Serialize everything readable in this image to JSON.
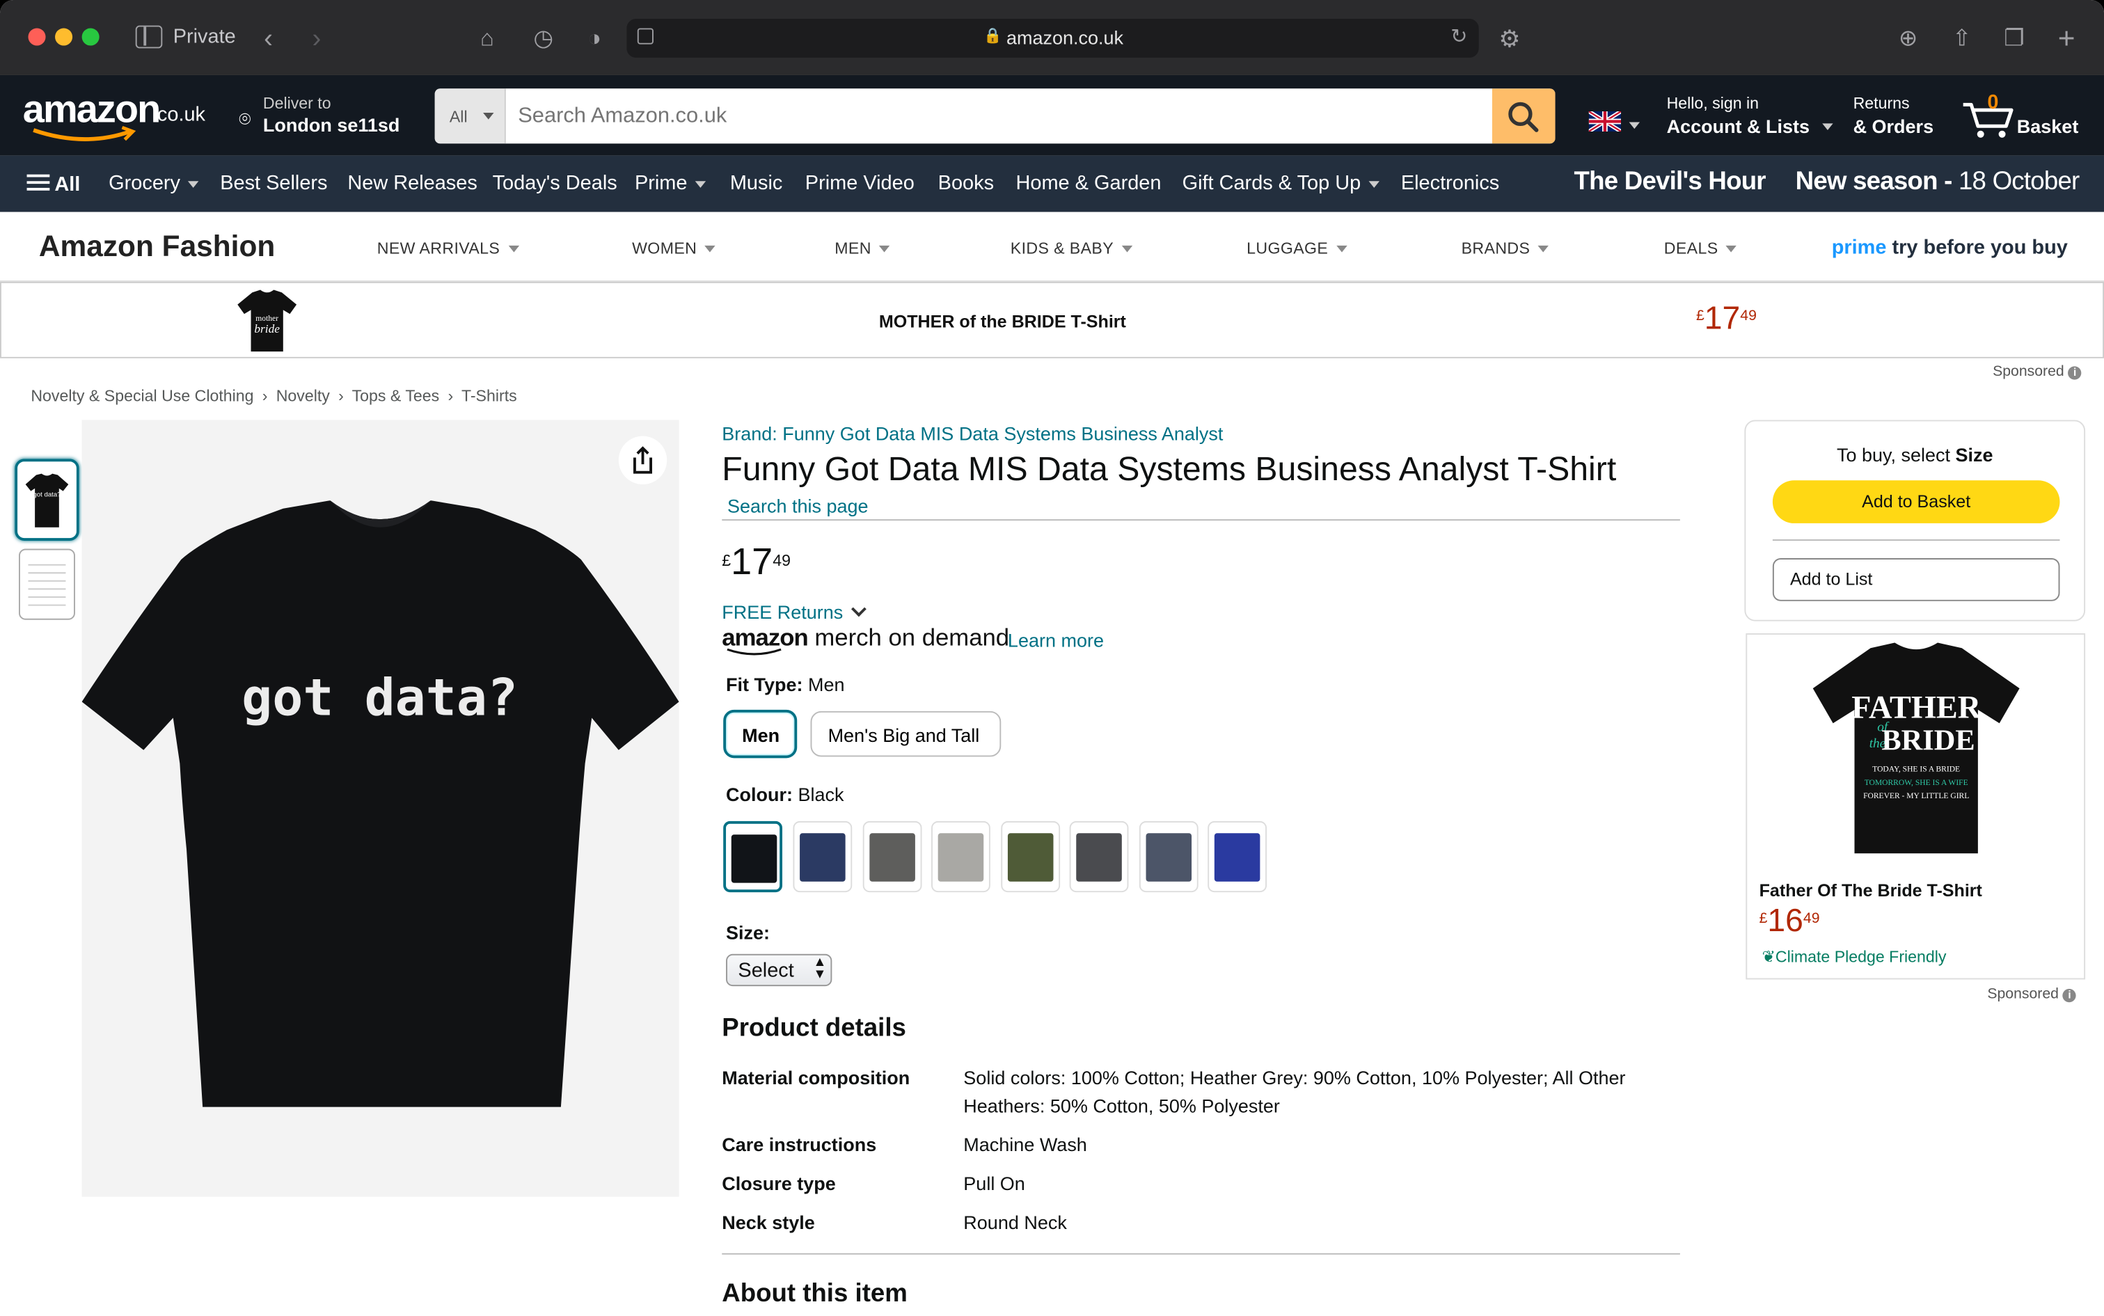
{
  "browser": {
    "private_label": "Private",
    "url": "amazon.co.uk"
  },
  "header": {
    "logo_text": "amazon",
    "logo_suffix": ".co.uk",
    "deliver_to": "Deliver to",
    "deliver_location": "London se11sd",
    "search_category": "All",
    "search_placeholder": "Search Amazon.co.uk",
    "account_line1": "Hello, sign in",
    "account_line2": "Account & Lists",
    "returns_line1": "Returns",
    "returns_line2": "& Orders",
    "basket_count": "0",
    "basket_label": "Basket"
  },
  "nav": {
    "all": "All",
    "items": [
      "Grocery",
      "Best Sellers",
      "New Releases",
      "Today's Deals",
      "Prime",
      "Music",
      "Prime Video",
      "Books",
      "Home & Garden",
      "Gift Cards & Top Up",
      "Electronics"
    ],
    "promo_title": "The Devil's Hour",
    "promo_sub_bold": "New season -",
    "promo_sub": " 18 October"
  },
  "fashion": {
    "title": "Amazon Fashion",
    "items": [
      "NEW ARRIVALS",
      "WOMEN",
      "MEN",
      "KIDS & BABY",
      "LUGGAGE",
      "BRANDS",
      "DEALS"
    ],
    "prime_word": "prime",
    "prime_tail": "try before you buy"
  },
  "sponsored_strip": {
    "product_name": "MOTHER of the BRIDE T-Shirt",
    "price_symbol": "£",
    "price_whole": "17",
    "price_fraction": "49",
    "sponsored": "Sponsored"
  },
  "breadcrumb": [
    "Novelty & Special Use Clothing",
    "Novelty",
    "Tops & Tees",
    "T-Shirts"
  ],
  "breadcrumb_sep": "›",
  "product": {
    "image_text": "got data?",
    "brand_link": "Brand: Funny Got Data MIS Data Systems Business Analyst",
    "title": "Funny Got Data MIS Data Systems Business Analyst T-Shirt",
    "search_page": "Search this page",
    "price_symbol": "£",
    "price_whole": "17",
    "price_fraction": "49",
    "free_returns": "FREE Returns",
    "merch_amazon": "amazon",
    "merch_rest": "merch on demand",
    "learn_more": "Learn more",
    "fit_type_label": "Fit Type:",
    "fit_type_value": "Men",
    "fit_options": [
      "Men",
      "Men's Big and Tall"
    ],
    "colour_label": "Colour:",
    "colour_value": "Black",
    "swatch_colors": [
      "#111418",
      "#2b3a63",
      "#5e5e5c",
      "#a9a8a4",
      "#4f5b37",
      "#4a4b4f",
      "#4c5568",
      "#2a3aa0"
    ],
    "size_label": "Size:",
    "size_select": "Select",
    "details_heading": "Product details",
    "details": [
      {
        "label": "Material composition",
        "value": "Solid colors: 100% Cotton; Heather Grey: 90% Cotton, 10% Polyester; All Other Heathers: 50% Cotton, 50% Polyester"
      },
      {
        "label": "Care instructions",
        "value": "Machine Wash"
      },
      {
        "label": "Closure type",
        "value": "Pull On"
      },
      {
        "label": "Neck style",
        "value": "Round Neck"
      }
    ],
    "about_heading": "About this item"
  },
  "buybox": {
    "select_prefix": "To buy, select ",
    "select_bold": "Size",
    "add_basket": "Add to Basket",
    "add_list": "Add to List"
  },
  "side_ad": {
    "shirt_line1": "FATHER",
    "shirt_of": "of",
    "shirt_the": "the",
    "shirt_line2": "BRIDE",
    "shirt_small1": "TODAY, SHE IS A BRIDE",
    "shirt_small2": "TOMORROW, SHE IS A WIFE",
    "shirt_small3": "FOREVER - MY LITTLE GIRL",
    "name": "Father Of The Bride T-Shirt",
    "price_symbol": "£",
    "price_whole": "16",
    "price_fraction": "49",
    "climate": "Climate Pledge Friendly",
    "sponsored": "Sponsored"
  },
  "colors": {
    "nav_dark": "#131921",
    "nav_mid": "#232f3e",
    "search_orange": "#febd69",
    "add_basket_yellow": "#ffd814",
    "link_teal": "#007185",
    "price_red": "#b12704"
  }
}
